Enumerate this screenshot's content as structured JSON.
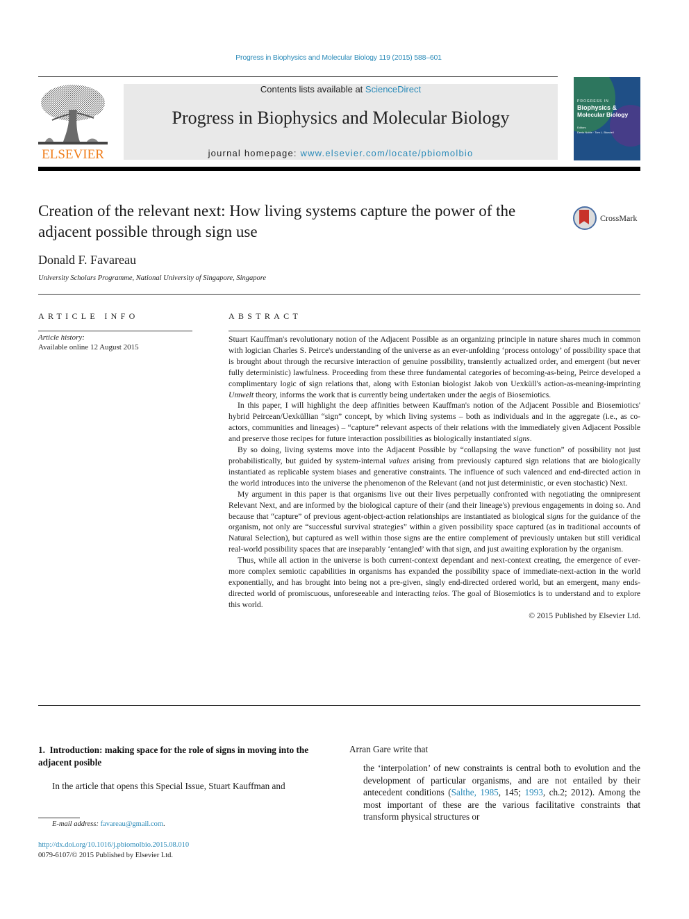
{
  "running_head": "Progress in Biophysics and Molecular Biology 119 (2015) 588–601",
  "masthead": {
    "contents_prefix": "Contents lists available at ",
    "contents_link": "ScienceDirect",
    "journal_title": "Progress in Biophysics and Molecular Biology",
    "homepage_prefix": "journal homepage: ",
    "homepage_link": "www.elsevier.com/locate/pbiomolbio",
    "publisher_wordmark": "ELSEVIER",
    "cover": {
      "line1": "PROGRESS IN",
      "line2": "Biophysics &",
      "line3": "Molecular Biology",
      "line4": "Editors",
      "line5": "Denis Noble · Tom L. Blundell"
    }
  },
  "article": {
    "title": "Creation of the relevant next: How living systems capture the power of the adjacent possible through sign use",
    "crossmark_label": "CrossMark",
    "author": "Donald F. Favareau",
    "affiliation": "University Scholars Programme, National University of Singapore, Singapore"
  },
  "article_info": {
    "heading": "ARTICLE INFO",
    "history_label": "Article history:",
    "history_value": "Available online 12 August 2015"
  },
  "abstract": {
    "heading": "ABSTRACT",
    "p1_a": "Stuart Kauffman's revolutionary notion of the Adjacent Possible as an organizing principle in nature shares much in common with logician Charles S. Peirce's understanding of the universe as an ever-unfolding ‘process ontology’ of possibility space that is brought about through the recursive interaction of genuine possibility, transiently actualized order, and emergent (but never fully deterministic) lawfulness. Proceeding from these three fundamental categories of becoming-as-being, Peirce developed a complimentary logic of sign relations that, along with Estonian biologist Jakob von Uexküll's action-as-meaning-imprinting ",
    "p1_em": "Umwelt",
    "p1_b": " theory, informs the work that is currently being undertaken under the aegis of Biosemiotics.",
    "p2_a": "In this paper, I will highlight the deep affinities between Kauffman's notion of the Adjacent Possible and Biosemiotics' hybrid Peircean/Uexküllian “sign” concept, by which living systems – both as individuals and in the aggregate (i.e., as co-actors, communities and lineages) – “capture” relevant aspects of their relations with the immediately given Adjacent Possible and preserve those recipes for future interaction possibilities as biologically instantiated ",
    "p2_em": "signs",
    "p2_b": ".",
    "p3_a": "By so doing, living systems move into the Adjacent Possible by “collapsing the wave function” of possibility not just probabilistically, but guided by system-internal ",
    "p3_em": "values",
    "p3_b": " arising from previously captured sign relations that are biologically instantiated as replicable system biases and generative constraints. The influence of such valenced and end-directed action in the world introduces into the universe the phenomenon of the Relevant (and not just deterministic, or even stochastic) Next.",
    "p4_a": "My argument in this paper is that organisms live out their lives perpetually confronted with negotiating the omnipresent Relevant Next, and are informed by the biological capture of their (and their lineage's) previous engagements in doing so. And because that “capture” of previous agent-object-action relationships are instantiated as biological ",
    "p4_em": "signs",
    "p4_b": " for the guidance of the organism, not only are “successful survival strategies” within a given possibility space captured (as in traditional accounts of Natural Selection), but captured as well within those signs are the entire complement of previously untaken but still veridical real-world possibility spaces that are inseparably ‘entangled’ with that sign, and just awaiting exploration by the organism.",
    "p5_a": "Thus, while all action in the universe is both current-context dependant and next-context creating, the emergence of ever-more complex semiotic capabilities in organisms has expanded the possibility space of immediate-next-action in the world exponentially, and has brought into being not a pre-given, singly end-directed ordered world, but an emergent, many ends-directed world of promiscuous, unforeseeable and interacting ",
    "p5_em": "telos",
    "p5_b": ". The goal of Biosemiotics is to understand and to explore this world.",
    "copyright": "© 2015 Published by Elsevier Ltd."
  },
  "body": {
    "section_heading": "1. Introduction: making space for the role of signs in moving into the adjacent posible",
    "intro_text": "In the article that opens this Special Issue, Stuart Kauffman and",
    "right_lead": "Arran Gare write that",
    "quote_a": "the ‘interpolation’ of new constraints is central both to evolution and the development of particular organisms, and are not entailed by their antecedent conditions (",
    "quote_ref1": "Salthe, 1985",
    "quote_b": ", 145; ",
    "quote_ref2": "1993",
    "quote_c": ", ch.2; 2012). Among the most important of these are the various facilitative constraints that transform physical structures or"
  },
  "footer": {
    "email_label": "E-mail address:",
    "email": "favareau@gmail.com",
    "email_suffix": ".",
    "doi": "http://dx.doi.org/10.1016/j.pbiomolbio.2015.08.010",
    "issn": "0079-6107/© 2015 Published by Elsevier Ltd."
  },
  "colors": {
    "link": "#2a8ab8",
    "elsevier_orange": "#f07d1a",
    "masthead_bg": "#e9e9e9"
  }
}
